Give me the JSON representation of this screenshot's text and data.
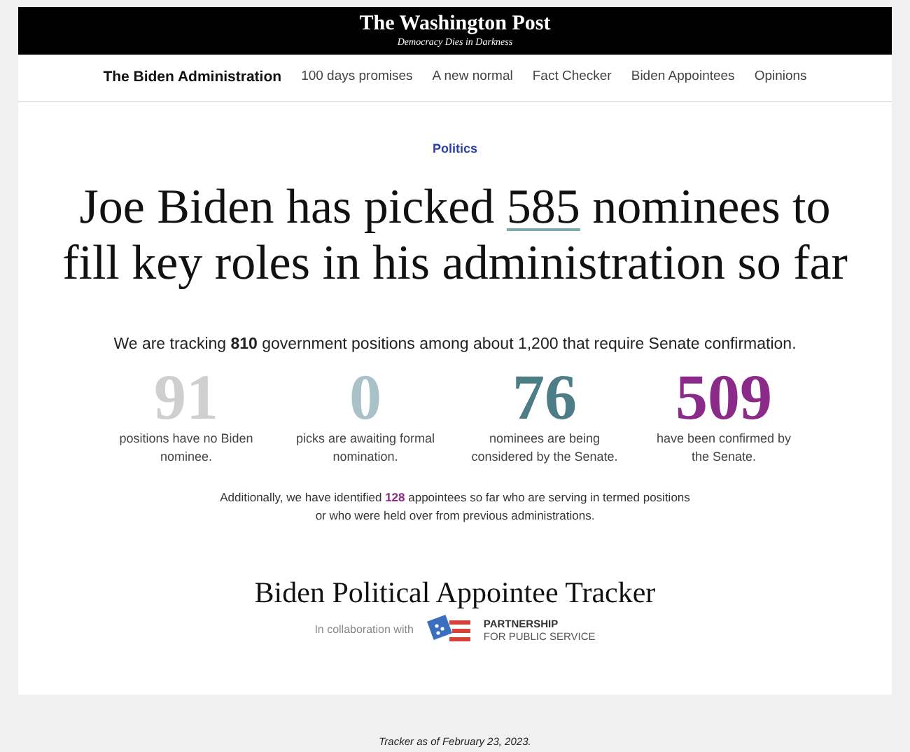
{
  "masthead": {
    "title": "The Washington Post",
    "tagline": "Democracy Dies in Darkness"
  },
  "nav": {
    "title": "The Biden Administration",
    "links": [
      "100 days promises",
      "A new normal",
      "Fact Checker",
      "Biden Appointees",
      "Opinions"
    ]
  },
  "section": "Politics",
  "headline": {
    "before": "Joe Biden has picked",
    "number": "585",
    "after": "nominees to fill key roles in his administration so far"
  },
  "summary": "We are tracking **810** government positions among about 1,200 that require Senate confirmation.",
  "stats": [
    {
      "value": "91",
      "label": "positions have no Biden nominee.",
      "color": "#cfcfcf"
    },
    {
      "value": "0",
      "label": "picks are awaiting formal nomination.",
      "color": "#a8c2c7"
    },
    {
      "value": "76",
      "label": "nominees are being considered by the Senate.",
      "color": "#4d7d86"
    },
    {
      "value": "509",
      "label": "have been confirmed by the Senate.",
      "color": "#8c2a8a"
    }
  ],
  "note": {
    "before": "Additionally, we have identified",
    "count": "128",
    "after": "appointees so far who are serving in termed positions or who were held over from previous administrations."
  },
  "tracker": {
    "title": "Biden Political Appointee Tracker",
    "collab": "In collaboration with",
    "partner_line1": "PARTNERSHIP",
    "partner_line2": "FOR PUBLIC SERVICE"
  },
  "footer": "Tracker as of February 23, 2023."
}
